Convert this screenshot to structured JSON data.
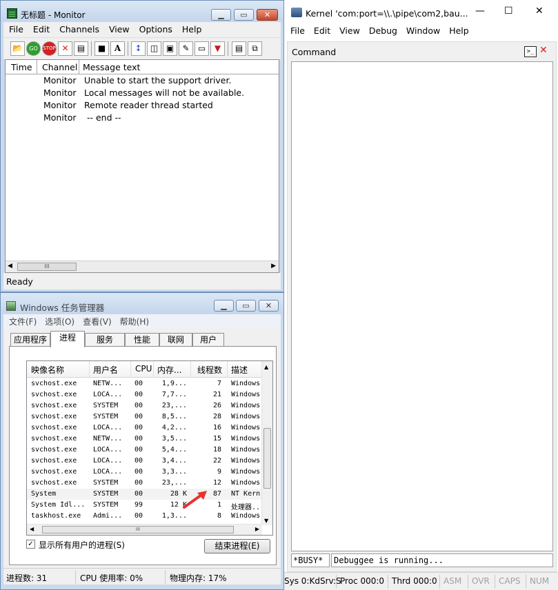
{
  "monitor": {
    "title": "无标题 - Monitor",
    "menu": [
      "File",
      "Edit",
      "Channels",
      "View",
      "Options",
      "Help"
    ],
    "columns": [
      "Time",
      "Channel",
      "Message text"
    ],
    "rows": [
      {
        "channel": "Monitor",
        "message": "Unable to start the support driver."
      },
      {
        "channel": "Monitor",
        "message": "Local messages will not be available."
      },
      {
        "channel": "Monitor",
        "message": "Remote reader thread started"
      },
      {
        "channel": "Monitor",
        "message": " -- end --"
      }
    ],
    "status": "Ready",
    "scroll_grip": "III"
  },
  "taskmgr": {
    "title": "Windows 任务管理器",
    "menu": [
      "文件(F)",
      "选项(O)",
      "查看(V)",
      "帮助(H)"
    ],
    "tabs": [
      "应用程序",
      "进程",
      "服务",
      "性能",
      "联网",
      "用户"
    ],
    "active_tab": "进程",
    "columns": [
      "映像名称",
      "用户名",
      "CPU",
      "内存...",
      "线程数",
      "描述"
    ],
    "rows": [
      {
        "name": "svchost.exe",
        "user": "NETW...",
        "cpu": "00",
        "mem": "1,9...",
        "threads": "7",
        "desc": "Windows"
      },
      {
        "name": "svchost.exe",
        "user": "LOCA...",
        "cpu": "00",
        "mem": "7,7...",
        "threads": "21",
        "desc": "Windows"
      },
      {
        "name": "svchost.exe",
        "user": "SYSTEM",
        "cpu": "00",
        "mem": "23,...",
        "threads": "26",
        "desc": "Windows"
      },
      {
        "name": "svchost.exe",
        "user": "SYSTEM",
        "cpu": "00",
        "mem": "8,5...",
        "threads": "28",
        "desc": "Windows"
      },
      {
        "name": "svchost.exe",
        "user": "LOCA...",
        "cpu": "00",
        "mem": "4,2...",
        "threads": "16",
        "desc": "Windows"
      },
      {
        "name": "svchost.exe",
        "user": "NETW...",
        "cpu": "00",
        "mem": "3,5...",
        "threads": "15",
        "desc": "Windows"
      },
      {
        "name": "svchost.exe",
        "user": "LOCA...",
        "cpu": "00",
        "mem": "5,4...",
        "threads": "18",
        "desc": "Windows"
      },
      {
        "name": "svchost.exe",
        "user": "LOCA...",
        "cpu": "00",
        "mem": "3,4...",
        "threads": "22",
        "desc": "Windows"
      },
      {
        "name": "svchost.exe",
        "user": "LOCA...",
        "cpu": "00",
        "mem": "3,3...",
        "threads": "9",
        "desc": "Windows"
      },
      {
        "name": "svchost.exe",
        "user": "SYSTEM",
        "cpu": "00",
        "mem": "23,...",
        "threads": "12",
        "desc": "Windows"
      },
      {
        "name": "System",
        "user": "SYSTEM",
        "cpu": "00",
        "mem": "28 K",
        "threads": "87",
        "desc": "NT Kern"
      },
      {
        "name": "System Idl...",
        "user": "SYSTEM",
        "cpu": "99",
        "mem": "12 K",
        "threads": "1",
        "desc": "处理器..."
      },
      {
        "name": "taskhost.exe",
        "user": "Admi...",
        "cpu": "00",
        "mem": "1,3...",
        "threads": "8",
        "desc": "Windows"
      }
    ],
    "show_all_label": "显示所有用户的进程(S)",
    "show_all_checked": "✓",
    "end_process_label": "结束进程(E)",
    "scroll_grip": "III",
    "status": {
      "processes": "进程数: 31",
      "cpu": "CPU 使用率: 0%",
      "memory": "物理内存: 17%"
    }
  },
  "kernel": {
    "title": "Kernel 'com:port=\\\\.\\pipe\\com2,bau...",
    "menu": [
      "File",
      "Edit",
      "View",
      "Debug",
      "Window",
      "Help"
    ],
    "panel_title": "Command",
    "busy": "*BUSY*",
    "input_text": "Debuggee is running...",
    "status": {
      "sys": "Sys 0:KdSrv:S",
      "proc": "Proc 000:0",
      "thrd": "Thrd 000:0",
      "asm": "ASM",
      "ovr": "OVR",
      "caps": "CAPS",
      "num": "NUM"
    }
  }
}
